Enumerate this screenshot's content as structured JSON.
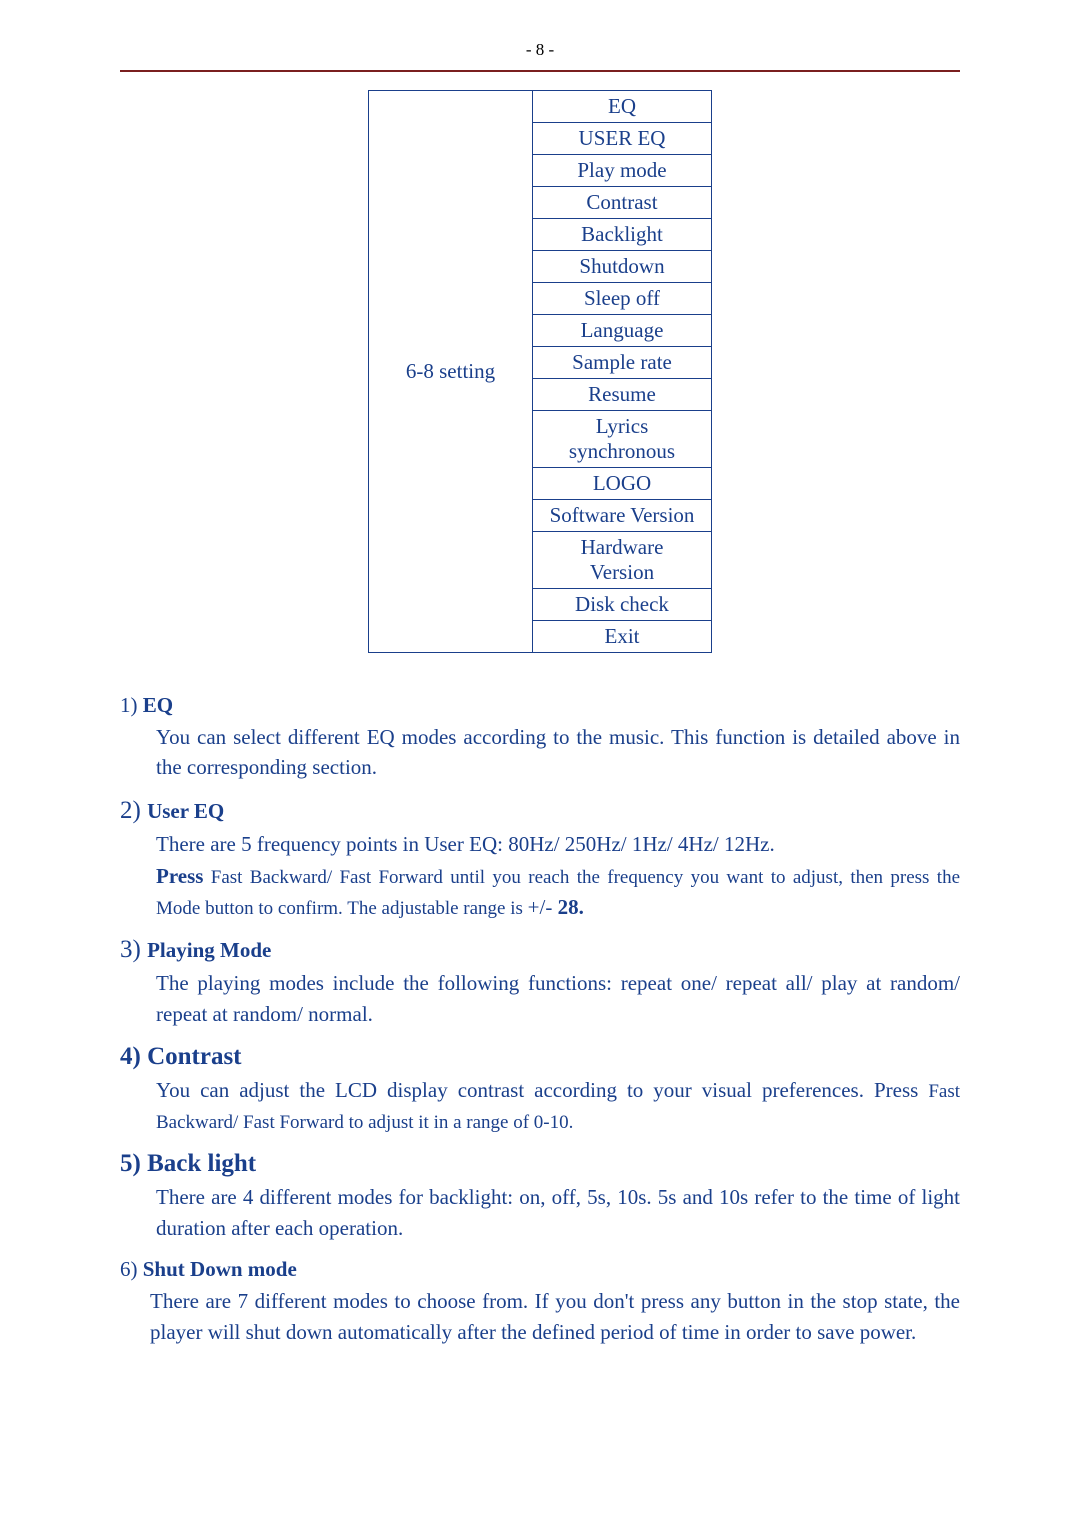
{
  "page_number_label": "- 8 -",
  "table": {
    "left_label": "6-8 setting",
    "rows": [
      "EQ",
      "USER EQ",
      "Play mode",
      "Contrast",
      "Backlight",
      "Shutdown",
      "Sleep off",
      "Language",
      "Sample rate",
      "Resume",
      "Lyrics synchronous",
      "LOGO",
      "Software Version",
      "Hardware Version",
      "Disk check",
      "Exit"
    ]
  },
  "sections": {
    "s1": {
      "num": "1) ",
      "title": "EQ",
      "body": "You can select different EQ modes according to the music. This function is detailed above in the corresponding section."
    },
    "s2": {
      "num": "2) ",
      "title": "User EQ",
      "line1": "There are 5 frequency points in User EQ: 80Hz/ 250Hz/ 1Hz/ 4Hz/ 12Hz.",
      "press_label": "Press",
      "line2a": " Fast Backward/ Fast Forward until you reach the frequency you want to adjust, then press the Mode button to confirm. The adjustable range is ",
      "range": "+/- ",
      "range_bold": "28."
    },
    "s3": {
      "num": "3) ",
      "title": "Playing Mode",
      "body": "The playing modes include the following functions: repeat one/ repeat all/ play at random/ repeat at random/ normal."
    },
    "s4": {
      "num": "4) ",
      "title": "Contrast",
      "body_a": "You can adjust the LCD display contrast according to your visual preferences. Press ",
      "body_b": "Fast Backward/ Fast Forward to adjust it in a range of 0-10."
    },
    "s5": {
      "num": "5) ",
      "title": "Back light",
      "body": "There are 4 different modes for backlight: on, off, 5s, 10s. 5s and 10s refer to the time of light duration after each operation."
    },
    "s6": {
      "num": "6) ",
      "title": "Shut Down mode",
      "body": "There are 7 different modes to choose from. If you don't press any button in the stop state, the player will shut down automatically after the defined period of time in order to save power."
    }
  }
}
